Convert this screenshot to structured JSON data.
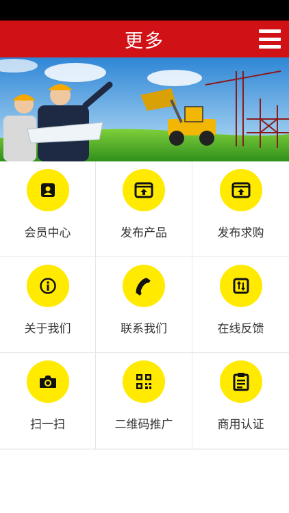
{
  "header": {
    "title": "更多",
    "menu_icon": "hamburger-menu-icon"
  },
  "colors": {
    "header": "#d01217",
    "icon_circle": "#ffea00"
  },
  "grid": {
    "items": [
      {
        "label": "会员中心",
        "icon": "member-card-icon"
      },
      {
        "label": "发布产品",
        "icon": "upload-window-icon"
      },
      {
        "label": "发布求购",
        "icon": "upload-window-icon"
      },
      {
        "label": "关于我们",
        "icon": "info-icon"
      },
      {
        "label": "联系我们",
        "icon": "phone-icon"
      },
      {
        "label": "在线反馈",
        "icon": "feedback-icon"
      },
      {
        "label": "扫一扫",
        "icon": "camera-icon"
      },
      {
        "label": "二维码推广",
        "icon": "qr-code-icon"
      },
      {
        "label": "商用认证",
        "icon": "clipboard-icon"
      }
    ]
  }
}
